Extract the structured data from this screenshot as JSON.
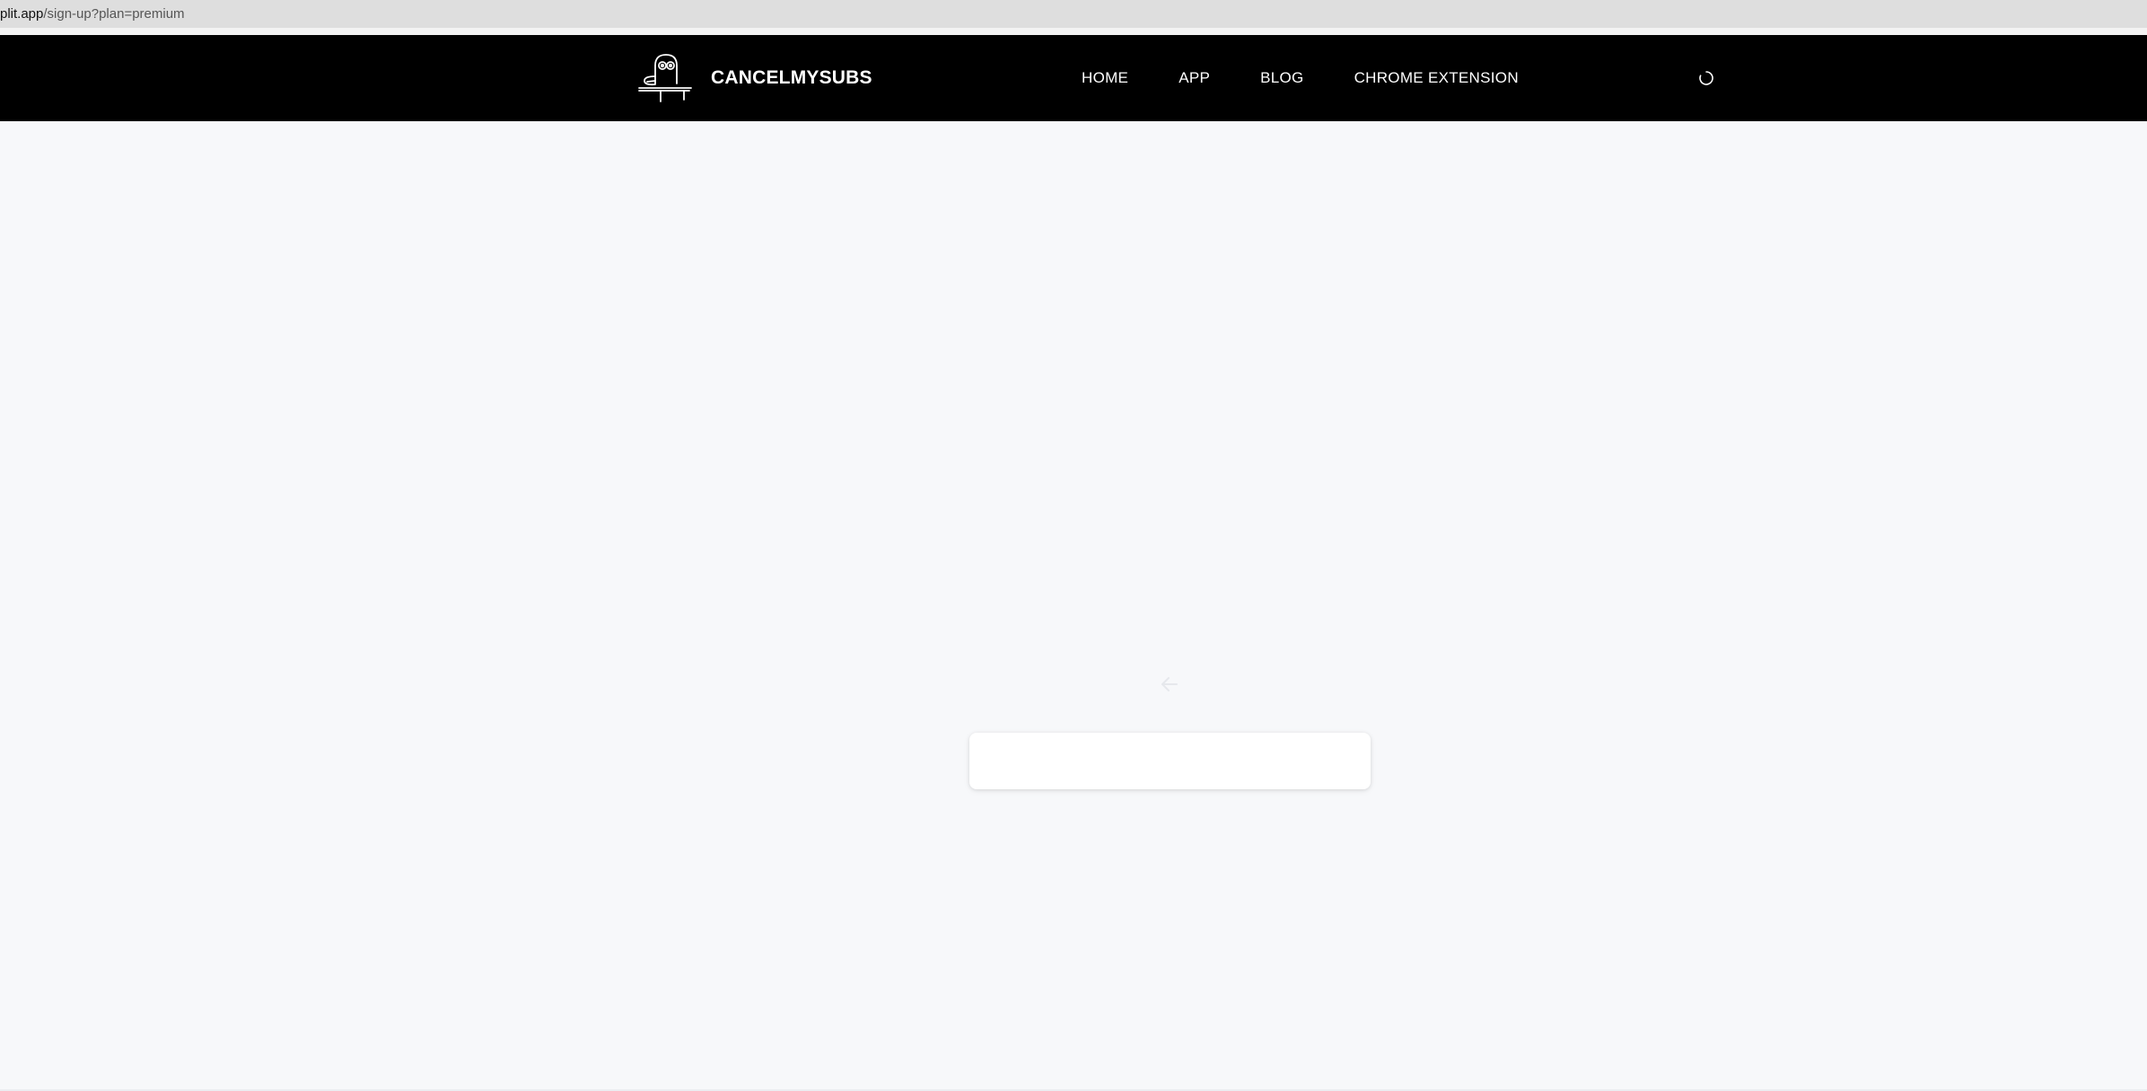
{
  "browser": {
    "url_host": "plit.app",
    "url_path": "/sign-up?plan=premium"
  },
  "header": {
    "brand_name": "CANCELMYSUBS",
    "logo_icon": "duck-mascot-icon",
    "nav": [
      {
        "label": "HOME"
      },
      {
        "label": "APP"
      },
      {
        "label": "BLOG"
      },
      {
        "label": "CHROME EXTENSION"
      }
    ],
    "status_icon": "loading-spinner-icon"
  },
  "main": {
    "placeholder_icon": "back-arrow-icon"
  },
  "colors": {
    "navbar_bg": "#000000",
    "page_bg": "#f7f8fa",
    "card_bg": "#ffffff",
    "nav_text": "#ffffff"
  }
}
